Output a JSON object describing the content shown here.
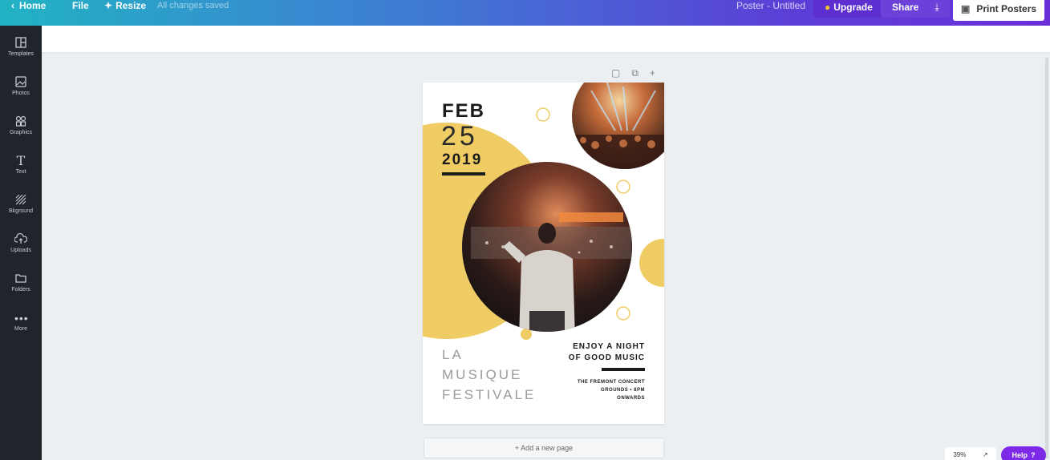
{
  "topbar": {
    "home": "Home",
    "file": "File",
    "resize": "Resize",
    "saved_status": "All changes saved",
    "document_title": "Poster - Untitled",
    "upgrade": "Upgrade",
    "share": "Share",
    "print": "Print Posters"
  },
  "sidebar": {
    "items": [
      {
        "label": "Templates",
        "icon": "templates-icon"
      },
      {
        "label": "Photos",
        "icon": "photos-icon"
      },
      {
        "label": "Graphics",
        "icon": "graphics-icon"
      },
      {
        "label": "Text",
        "icon": "text-icon"
      },
      {
        "label": "Bkground",
        "icon": "background-icon"
      },
      {
        "label": "Uploads",
        "icon": "uploads-icon"
      },
      {
        "label": "Folders",
        "icon": "folders-icon"
      },
      {
        "label": "More",
        "icon": "more-icon"
      }
    ]
  },
  "poster": {
    "month": "FEB",
    "day": "25",
    "year": "2019",
    "title_lines": [
      "LA",
      "MUSIQUE",
      "FESTIVALE"
    ],
    "tagline_lines": [
      "ENJOY A NIGHT",
      "OF GOOD MUSIC"
    ],
    "venue_lines": [
      "THE FREMONT CONCERT",
      "GROUNDS • 8PM",
      "ONWARDS"
    ],
    "colors": {
      "accent": "#f0cc65",
      "dark": "#1b1b1b"
    }
  },
  "canvas": {
    "add_page": "+ Add a new page"
  },
  "footer": {
    "zoom": "39%",
    "help": "Help"
  }
}
